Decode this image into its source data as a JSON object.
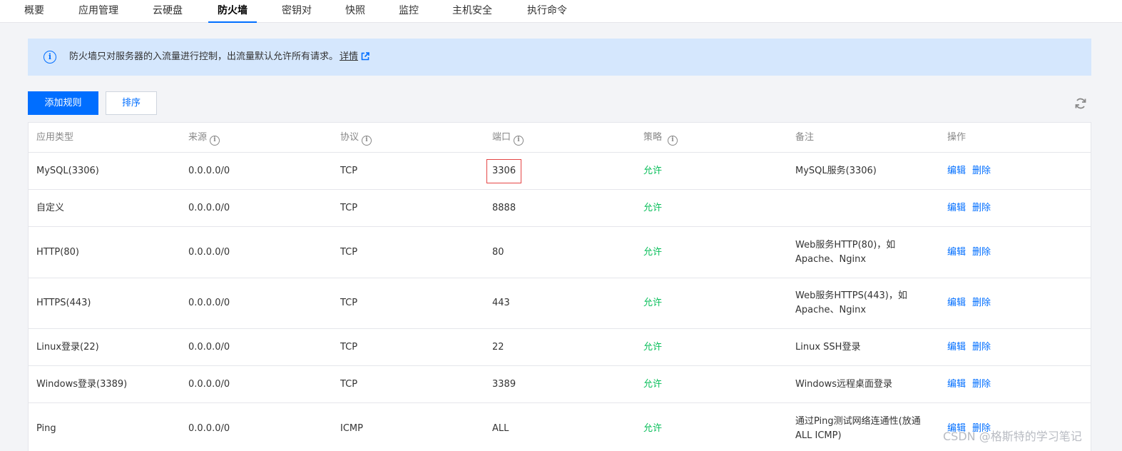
{
  "tabs": [
    {
      "label": "概要"
    },
    {
      "label": "应用管理"
    },
    {
      "label": "云硬盘"
    },
    {
      "label": "防火墙"
    },
    {
      "label": "密钥对"
    },
    {
      "label": "快照"
    },
    {
      "label": "监控"
    },
    {
      "label": "主机安全"
    },
    {
      "label": "执行命令"
    }
  ],
  "active_tab": "防火墙",
  "banner": {
    "message": "防火墙只对服务器的入流量进行控制，出流量默认允许所有请求。",
    "link_text": "详情"
  },
  "toolbar": {
    "add_rule_label": "添加规则",
    "sort_label": "排序"
  },
  "table": {
    "headers": {
      "app_type": "应用类型",
      "source": "来源",
      "protocol": "协议",
      "port": "端口",
      "policy": "策略",
      "remark": "备注",
      "action": "操作"
    },
    "edit_label": "编辑",
    "delete_label": "删除",
    "rows": [
      {
        "app_type": "MySQL(3306)",
        "source": "0.0.0.0/0",
        "protocol": "TCP",
        "port": "3306",
        "policy": "允许",
        "remark": "MySQL服务(3306)",
        "port_highlighted": true
      },
      {
        "app_type": "自定义",
        "source": "0.0.0.0/0",
        "protocol": "TCP",
        "port": "8888",
        "policy": "允许",
        "remark": ""
      },
      {
        "app_type": "HTTP(80)",
        "source": "0.0.0.0/0",
        "protocol": "TCP",
        "port": "80",
        "policy": "允许",
        "remark": "Web服务HTTP(80)，如\nApache、Nginx"
      },
      {
        "app_type": "HTTPS(443)",
        "source": "0.0.0.0/0",
        "protocol": "TCP",
        "port": "443",
        "policy": "允许",
        "remark": "Web服务HTTPS(443)，如\nApache、Nginx"
      },
      {
        "app_type": "Linux登录(22)",
        "source": "0.0.0.0/0",
        "protocol": "TCP",
        "port": "22",
        "policy": "允许",
        "remark": "Linux SSH登录"
      },
      {
        "app_type": "Windows登录(3389)",
        "source": "0.0.0.0/0",
        "protocol": "TCP",
        "port": "3389",
        "policy": "允许",
        "remark": "Windows远程桌面登录"
      },
      {
        "app_type": "Ping",
        "source": "0.0.0.0/0",
        "protocol": "ICMP",
        "port": "ALL",
        "policy": "允许",
        "remark": "通过Ping测试网络连通性(放通\nALL ICMP)"
      }
    ]
  },
  "watermark": "CSDN @格斯特的学习笔记",
  "colors": {
    "accent": "#006eff",
    "allow": "#0abf5b",
    "highlight_border": "#e54545",
    "banner_bg": "#d5e7fd"
  }
}
